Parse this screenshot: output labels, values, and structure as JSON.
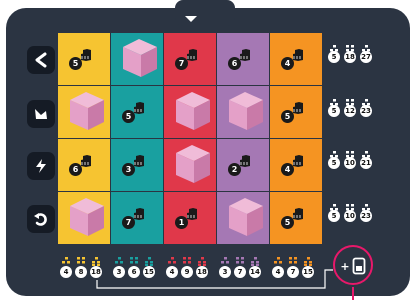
{
  "colors": {
    "board": "#2b3442",
    "button_bg": "#151b25",
    "accent": "#e8186a",
    "cube_face": "#e4a0c8",
    "cube_side": "#c97aa8",
    "cube_top": "#f0bcd8"
  },
  "menu": {
    "toggle_icon": "chevron-down-icon"
  },
  "side_buttons": [
    {
      "icon": "back-icon",
      "label": "<"
    },
    {
      "icon": "bird-icon",
      "label": ""
    },
    {
      "icon": "lightning-icon",
      "label": ""
    },
    {
      "icon": "undo-icon",
      "label": ""
    }
  ],
  "grid": {
    "rows": [
      [
        {
          "color": "#f6c431",
          "content": "clue",
          "number": "5"
        },
        {
          "color": "#19a0a0",
          "content": "cube",
          "number": ""
        },
        {
          "color": "#e0384a",
          "content": "clue",
          "number": "7"
        },
        {
          "color": "#a578b4",
          "content": "clue",
          "number": "6"
        },
        {
          "color": "#f59422",
          "content": "clue",
          "number": "4"
        }
      ],
      [
        {
          "color": "#f6c431",
          "content": "cube",
          "number": ""
        },
        {
          "color": "#19a0a0",
          "content": "clue",
          "number": "5"
        },
        {
          "color": "#e0384a",
          "content": "cube",
          "number": ""
        },
        {
          "color": "#a578b4",
          "content": "cube",
          "number": ""
        },
        {
          "color": "#f59422",
          "content": "clue",
          "number": "5"
        }
      ],
      [
        {
          "color": "#f6c431",
          "content": "clue",
          "number": "6"
        },
        {
          "color": "#19a0a0",
          "content": "clue",
          "number": "3"
        },
        {
          "color": "#e0384a",
          "content": "cube",
          "number": ""
        },
        {
          "color": "#a578b4",
          "content": "clue",
          "number": "2"
        },
        {
          "color": "#f59422",
          "content": "clue",
          "number": "4"
        }
      ],
      [
        {
          "color": "#f6c431",
          "content": "cube",
          "number": ""
        },
        {
          "color": "#19a0a0",
          "content": "clue",
          "number": "7"
        },
        {
          "color": "#e0384a",
          "content": "clue",
          "number": "1"
        },
        {
          "color": "#a578b4",
          "content": "cube",
          "number": ""
        },
        {
          "color": "#f59422",
          "content": "clue",
          "number": "5"
        }
      ]
    ]
  },
  "row_clues": [
    {
      "values": [
        "5",
        "18",
        "27"
      ]
    },
    {
      "values": [
        "5",
        "12",
        "23"
      ]
    },
    {
      "values": [
        "5",
        "10",
        "21"
      ]
    },
    {
      "values": [
        "5",
        "10",
        "23"
      ]
    }
  ],
  "col_clues": [
    {
      "values": [
        "4",
        "8",
        "18"
      ]
    },
    {
      "values": [
        "3",
        "6",
        "15"
      ]
    },
    {
      "values": [
        "4",
        "9",
        "18"
      ]
    },
    {
      "values": [
        "3",
        "7",
        "14"
      ]
    },
    {
      "values": [
        "4",
        "7",
        "15"
      ]
    }
  ],
  "add_button": {
    "label": "+"
  }
}
